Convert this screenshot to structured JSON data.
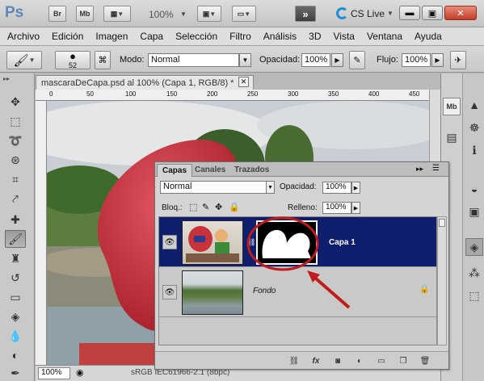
{
  "app": {
    "logo": "Ps",
    "bridge": "Br",
    "minibridge": "Mb",
    "zoom": "100%",
    "cs_live": "CS Live"
  },
  "menu": [
    "Archivo",
    "Edición",
    "Imagen",
    "Capa",
    "Selección",
    "Filtro",
    "Análisis",
    "3D",
    "Vista",
    "Ventana",
    "Ayuda"
  ],
  "options": {
    "brush_size": "52",
    "mode_label": "Modo:",
    "mode_value": "Normal",
    "opacity_label": "Opacidad:",
    "opacity_value": "100%",
    "flow_label": "Flujo:",
    "flow_value": "100%"
  },
  "document": {
    "tab_title": "mascaraDeCapa.psd al 100% (Capa 1, RGB/8) *",
    "ruler_ticks": [
      "0",
      "50",
      "100",
      "150",
      "200",
      "250",
      "300",
      "350",
      "400",
      "450"
    ],
    "zoom": "100%",
    "status": "sRGB IEC61966-2.1 (8bpc)"
  },
  "layers_panel": {
    "tabs": [
      "Capas",
      "Canales",
      "Trazados"
    ],
    "blend_mode": "Normal",
    "opacity_label": "Opacidad:",
    "opacity_value": "100%",
    "lock_label": "Bloq.:",
    "fill_label": "Relleno:",
    "fill_value": "100%",
    "layers": [
      {
        "name": "Capa 1",
        "selected": true
      },
      {
        "name": "Fondo",
        "selected": false
      }
    ]
  },
  "colors": {
    "accent": "#0f1f6d",
    "arrow": "#c21b1b",
    "balloon": "#c8323a"
  }
}
